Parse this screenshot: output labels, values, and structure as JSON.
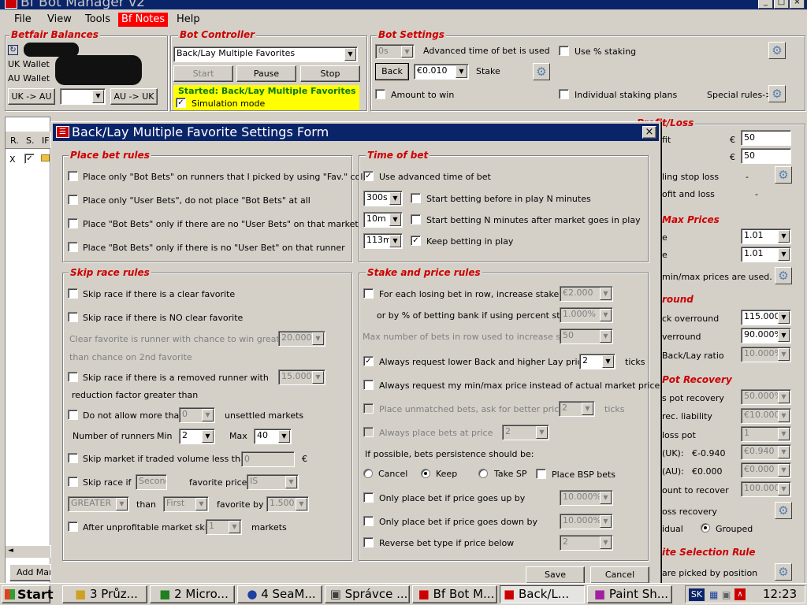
{
  "app": {
    "title": "Bf Bot Manager v2"
  },
  "menu": [
    "File",
    "View",
    "Tools",
    "Bf Notes",
    "Help"
  ],
  "balances": {
    "title": "Betfair Balances",
    "uk_label": "UK Wallet",
    "au_label": "AU Wallet",
    "uk_to_au": "UK -> AU",
    "au_to_uk": "AU -> UK",
    "amount": ""
  },
  "controller": {
    "title": "Bot Controller",
    "strategy": "Back/Lay Multiple Favorites",
    "start": "Start",
    "pause": "Pause",
    "stop": "Stop",
    "status": "Started: Back/Lay Multiple Favorites",
    "simulation": "Simulation mode"
  },
  "settings": {
    "title": "Bot Settings",
    "time_value": "0s",
    "advanced_time": "Advanced time of bet is used",
    "use_pct": "Use % staking",
    "back": "Back",
    "stake_value": "€0.010",
    "stake": "Stake",
    "amount_to_win": "Amount to win",
    "individual": "Individual staking plans",
    "special": "Special rules->"
  },
  "grid": {
    "headers": [
      "R.",
      "S.",
      "IF"
    ],
    "row": [
      "X"
    ]
  },
  "add_market": "Add Mar",
  "right_panel": {
    "profit_loss": {
      "title": "Profit/Loss",
      "r1_label": "fit",
      "r1_value": "50",
      "r2_value": "50",
      "r3": "ling stop loss",
      "r3_dash": "-",
      "r4": "ofit and loss",
      "r4_dash": "-",
      "cur1": "€",
      "cur2": "€"
    },
    "prices": {
      "title": "Max Prices",
      "r1_label": "e",
      "r1_value": "1.01",
      "r2_label": "e",
      "r2_value": "1.01",
      "note": "min/max prices are used."
    },
    "overround": {
      "title": "round",
      "r1_label": "ck overround",
      "r1_value": "115.000",
      "r2_label": "verround",
      "r2_value": "90.000%",
      "r3_label": "Back/Lay ratio",
      "r3_value": "10.000%"
    },
    "pot": {
      "title": "Pot Recovery",
      "r1_label": "s pot recovery",
      "r1_value": "50.000%",
      "r2_label": "rec. liability",
      "r2_value": "€10.000",
      "r3_label": "loss pot",
      "r3_value": "1",
      "r4_label": "(UK):",
      "r4_mid": "€-0.940",
      "r4_value": "€0.940",
      "r5_label": "(AU):",
      "r5_mid": "€0.000",
      "r5_value": "€0.000",
      "r6_label": "ount to recover",
      "r6_value": "100.000",
      "r7_label": "oss recovery",
      "individual": "idual",
      "grouped": "Grouped"
    },
    "selection": {
      "title": "ite Selection Rule",
      "note": "are picked by position"
    }
  },
  "dialog": {
    "title": "Back/Lay Multiple Favorite Settings Form",
    "place_bet": {
      "title": "Place bet rules",
      "items": [
        "Place only \"Bot Bets\" on runners that I picked by using \"Fav.\" col.",
        "Place only \"User Bets\", do not place \"Bot Bets\" at all",
        "Place \"Bot Bets\" only if there are no \"User Bets\" on that market",
        "Place \"Bot Bets\" only if there is no \"User Bet\" on that runner"
      ]
    },
    "time_of_bet": {
      "title": "Time of bet",
      "use_advanced": "Use advanced time of bet",
      "v1": "300s",
      "l1": "Start betting before in play N minutes",
      "v2": "10m",
      "l2": "Start betting N minutes after market goes in play",
      "v3": "113m",
      "l3": "Keep betting in play"
    },
    "skip_race": {
      "title": "Skip race rules",
      "clear_fav": "Skip race if there is a clear favorite",
      "no_clear_fav": "Skip race if there is NO clear favorite",
      "clear_fav_desc1": "Clear favorite is runner with chance to win greater by",
      "clear_fav_desc2": "than chance on 2nd favorite",
      "clear_fav_value": "20.000%",
      "removed1": "Skip race if there is a removed runner with",
      "removed2": "reduction factor greater than",
      "removed_value": "15.000%",
      "unsettled": "Do not allow more than",
      "unsettled_value": "0",
      "unsettled_suffix": "unsettled markets",
      "runners": "Number of runners",
      "min": "Min",
      "min_value": "2",
      "max": "Max",
      "max_value": "40",
      "volume": "Skip market if traded volume less than",
      "volume_value": "0",
      "volume_cur": "€",
      "skip_if": "Skip race if",
      "second": "Second",
      "fav_price": "favorite price",
      "is": "IS",
      "greater": "GREATER",
      "than": "than",
      "first": "First",
      "fav_by": "favorite by",
      "by_value": "1.500",
      "unprofitable": "After unprofitable market skip",
      "unprofitable_value": "1",
      "markets": "markets"
    },
    "stake_price": {
      "title": "Stake and price rules",
      "losing": "For each losing bet in row, increase stake by",
      "losing_value": "€2.000",
      "or_by": "or by % of betting bank if using percent staking",
      "or_by_value": "1.000%",
      "max_bets": "Max number of bets in row used to increase stake",
      "max_bets_value": "50",
      "lower_back": "Always request lower Back and higher Lay price by",
      "lower_back_value": "2",
      "ticks": "ticks",
      "minmax": "Always request my min/max price instead of actual market price",
      "unmatched": "Place unmatched bets, ask for better price by",
      "unmatched_value": "2",
      "ticks2": "ticks",
      "always_place": "Always place bets at price",
      "always_place_value": "2",
      "persistence": "If possible, bets persistence should be:",
      "cancel": "Cancel",
      "keep": "Keep",
      "take_sp": "Take SP",
      "bsp": "Place BSP bets",
      "up": "Only place bet if price goes up by",
      "up_value": "10.000%",
      "down": "Only place bet if price goes down by",
      "down_value": "10.000%",
      "reverse": "Reverse bet type if price below",
      "reverse_value": "2"
    },
    "save": "Save",
    "cancel": "Cancel"
  },
  "taskbar": {
    "start": "Start",
    "tasks": [
      "3 Průz...",
      "2 Micro...",
      "4 SeaM...",
      "Správce ...",
      "Bf Bot M...",
      "Back/L...",
      "Paint Sh..."
    ],
    "lang": "SK",
    "clock": "12:23"
  },
  "colors": {
    "accent_red": "#cc0000",
    "title_blue": "#0a246a",
    "status_yellow": "#ffff00"
  }
}
